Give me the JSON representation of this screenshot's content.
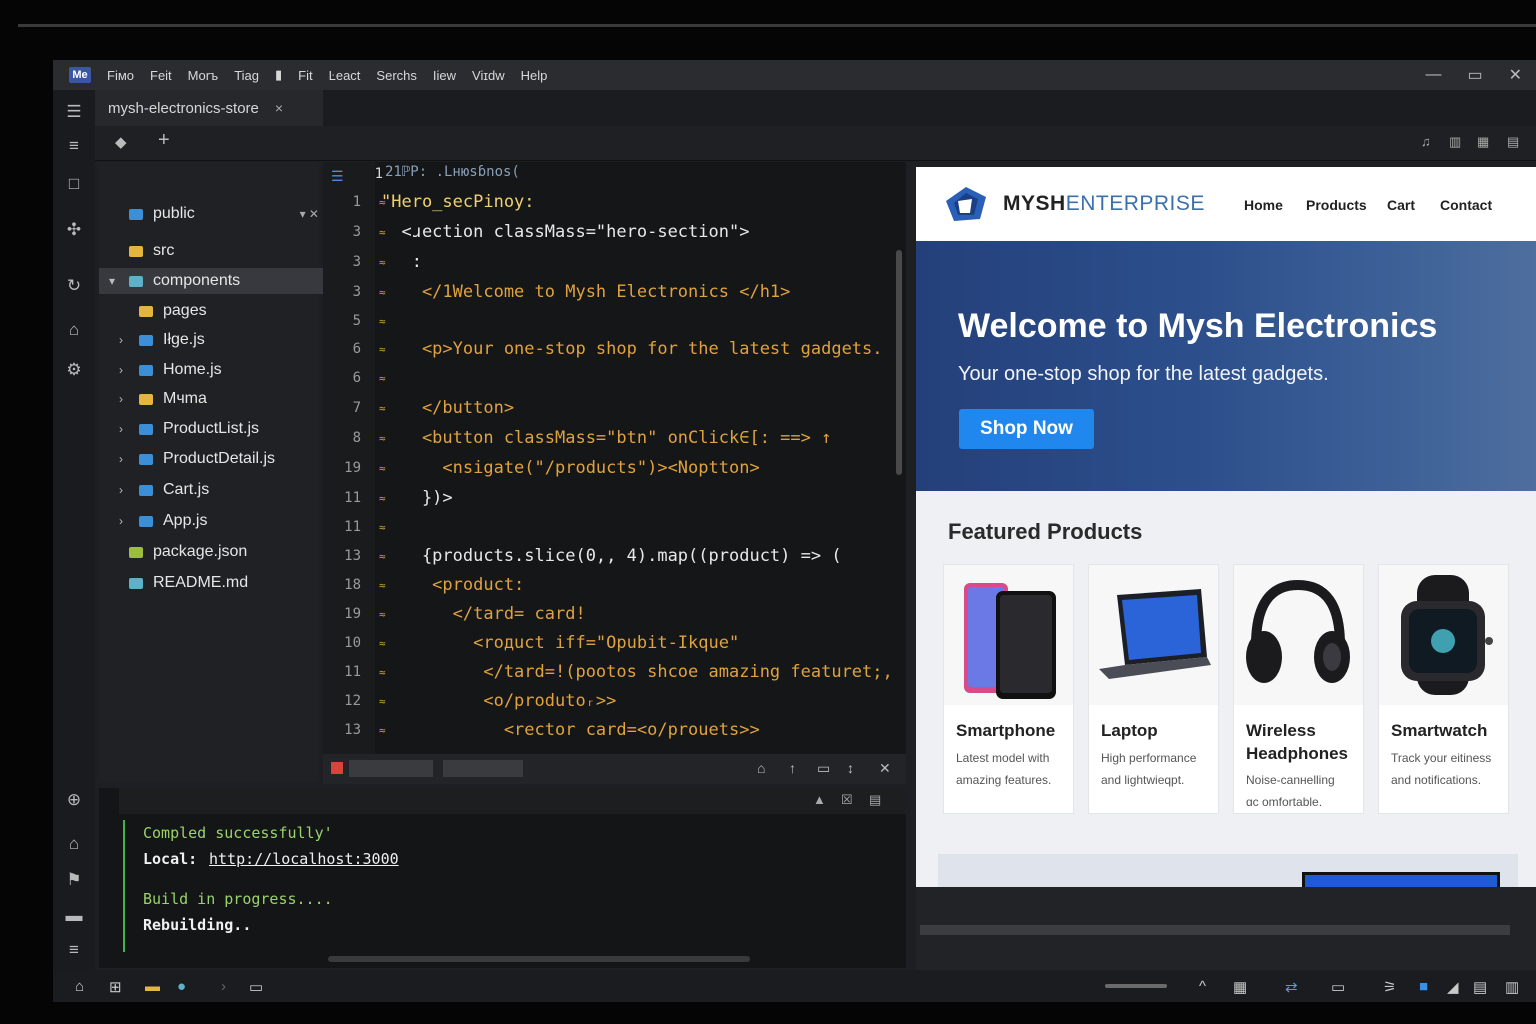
{
  "app": {
    "badge": "Me"
  },
  "menu": [
    "Fiмо",
    "Feit",
    "Morъ",
    "Tiag",
    "Fit",
    "Ŀeact",
    "Serchs",
    "Iiew",
    "Viɪdw",
    "Help"
  ],
  "tab": {
    "title": "mysh-electronics-store",
    "close": "×"
  },
  "explorer": {
    "items": [
      {
        "label": "public",
        "icon": "folder-icon",
        "color": "b",
        "indent": 0,
        "chev": ""
      },
      {
        "label": "src",
        "icon": "folder-icon",
        "color": "y",
        "indent": 0,
        "chev": ""
      },
      {
        "label": "components",
        "icon": "folder-icon",
        "color": "c",
        "indent": 1,
        "chev": "▾",
        "selected": true
      },
      {
        "label": "pages",
        "icon": "folder-icon",
        "color": "y",
        "indent": 2,
        "chev": ""
      },
      {
        "label": "Iłge.js",
        "icon": "file-icon",
        "color": "b",
        "indent": 2,
        "chev": "›"
      },
      {
        "label": "Home.js",
        "icon": "file-icon",
        "color": "b",
        "indent": 2,
        "chev": "›"
      },
      {
        "label": "Mчma",
        "icon": "folder-icon",
        "color": "y",
        "indent": 2,
        "chev": "›"
      },
      {
        "label": "ProductList.js",
        "icon": "file-icon",
        "color": "b",
        "indent": 2,
        "chev": "›"
      },
      {
        "label": "ProductDetail.js",
        "icon": "file-icon",
        "color": "b",
        "indent": 2,
        "chev": "›"
      },
      {
        "label": "Cart.js",
        "icon": "file-icon",
        "color": "b",
        "indent": 2,
        "chev": "›"
      },
      {
        "label": "App.js",
        "icon": "file-icon",
        "color": "b",
        "indent": 2,
        "chev": "›"
      },
      {
        "label": "package.json",
        "icon": "json-file-icon",
        "color": "g",
        "indent": 0,
        "chev": ""
      },
      {
        "label": "README.md",
        "icon": "markdown-file-icon",
        "color": "c",
        "indent": 0,
        "chev": ""
      }
    ]
  },
  "editor": {
    "lines": [
      {
        "n": "1",
        "code": "21ℙP: .Lнюsɓnos("
      },
      {
        "n": "1",
        "code": "\"Hero_secPinoy:"
      },
      {
        "n": "3",
        "code": "  <ɹection classMass=\"hero-section\">"
      },
      {
        "n": "3",
        "code": "   :"
      },
      {
        "n": "3",
        "code": "    </1Welcome to Mysh Electronics </h1>"
      },
      {
        "n": "5",
        "code": ""
      },
      {
        "n": "6",
        "code": "    <p>Your one-stop shop for the latest gadgets."
      },
      {
        "n": "6",
        "code": ""
      },
      {
        "n": "7",
        "code": "    </button>"
      },
      {
        "n": "8",
        "code": "    <button classMass=\"btn\" onClick∈[: ==> ↑"
      },
      {
        "n": "19",
        "code": "      <nsigate(\"/products\")><Noptton>"
      },
      {
        "n": "11",
        "code": "    })>"
      },
      {
        "n": "11",
        "code": ""
      },
      {
        "n": "13",
        "code": "    {products.slice(0,, 4).map((product) => ("
      },
      {
        "n": "18",
        "code": "     <product:"
      },
      {
        "n": "19",
        "code": "       </tard= card!"
      },
      {
        "n": "10",
        "code": "         <rодuct iff=\"Opubit-Ikque\""
      },
      {
        "n": "11",
        "code": "          </tard=!(pootos shcoe amazing featuret;,"
      },
      {
        "n": "12",
        "code": "          <o/produtoᵣ>>"
      },
      {
        "n": "13",
        "code": "            <rector card=<o/prouets>>"
      }
    ]
  },
  "terminal": {
    "compiled": "Compled successfully'",
    "local_label": "Local:",
    "local_url": "http://localhost:3000",
    "build": "Build in progress....",
    "rebuilding": "Rebuilding.."
  },
  "preview": {
    "brand_bold": "MYSH",
    "brand_light": "ENTERPRISE",
    "nav": [
      "Home",
      "Products",
      "Cart",
      "Contact"
    ],
    "hero_title": "Welcome to Mysh Electronics",
    "hero_sub": "Your one-stop shop for the latest gadgets.",
    "hero_button": "Shop Now",
    "featured_title": "Featured Products",
    "products": [
      {
        "name": "Smartphone",
        "desc": [
          "Latest model with",
          "amazing features."
        ],
        "icon": "smartphone-icon"
      },
      {
        "name": "Laptop",
        "desc": [
          "High performance",
          "and lightwieqpt."
        ],
        "icon": "laptop-icon"
      },
      {
        "name": "Wireless Headphones",
        "desc": [
          "Noise-canнelling",
          "ɑc omfortable."
        ],
        "icon": "headphones-icon"
      },
      {
        "name": "Smartwatch",
        "desc": [
          "Track your eitiness",
          "and notifications."
        ],
        "icon": "smartwatch-icon"
      }
    ]
  },
  "colors": {
    "accent": "#1f87ee",
    "hero": "#2c4f8c",
    "tag": "#e0a23c",
    "string": "#79c6e8",
    "success": "#46b04a"
  }
}
